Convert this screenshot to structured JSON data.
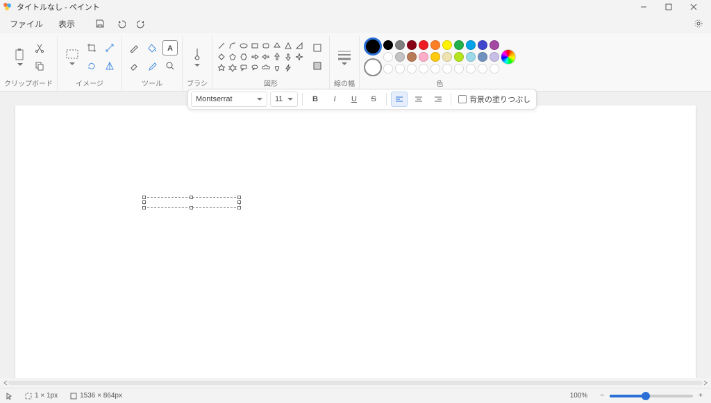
{
  "window": {
    "title": "タイトルなし - ペイント"
  },
  "menu": {
    "file": "ファイル",
    "view": "表示"
  },
  "ribbon": {
    "clipboard_label": "クリップボード",
    "image_label": "イメージ",
    "tools_label": "ツール",
    "brushes_label": "ブラシ",
    "shapes_label": "図形",
    "stroke_label": "線の幅",
    "colors_label": "色"
  },
  "text_toolbar": {
    "font": "Montserrat",
    "size": "11",
    "fill_bg_label": "背景の塗りつぶし"
  },
  "colors": {
    "primary": "#000000",
    "secondary": "#ffffff",
    "palette_row1": [
      "#000000",
      "#7f7f7f",
      "#880015",
      "#ed1c24",
      "#ff7f27",
      "#fff200",
      "#22b14c",
      "#00a2e8",
      "#3f48cc",
      "#a349a4"
    ],
    "palette_row2": [
      "#ffffff",
      "#c3c3c3",
      "#b97a57",
      "#ffaec9",
      "#ffc90e",
      "#efe4b0",
      "#b5e61d",
      "#99d9ea",
      "#7092be",
      "#c8bfe7"
    ]
  },
  "status": {
    "selection_size": "1 × 1px",
    "canvas_size": "1536 × 864px",
    "zoom": "100%"
  }
}
